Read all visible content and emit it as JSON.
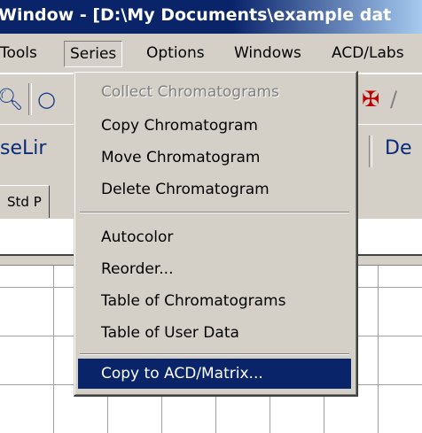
{
  "window": {
    "title": "Window - [D:\\My Documents\\example dat"
  },
  "menubar": {
    "items": [
      "Tools",
      "Series",
      "Options",
      "Windows",
      "ACD/Labs"
    ]
  },
  "toolbar": {
    "icons": [
      "zoom-icon",
      "pan-icon",
      "peak-marker-icon",
      "baseline-icon"
    ]
  },
  "toolbar2": {
    "left_label": "seLir",
    "right_label": "De"
  },
  "tabs": {
    "first": "Std P"
  },
  "series_menu": {
    "items": [
      {
        "label": "Collect Chromatograms",
        "state": "disabled"
      },
      {
        "label": "Copy Chromatogram",
        "state": "normal"
      },
      {
        "label": "Move Chromatogram",
        "state": "normal"
      },
      {
        "label": "Delete Chromatogram",
        "state": "normal"
      },
      {
        "label": "Autocolor",
        "state": "normal"
      },
      {
        "label": "Reorder...",
        "state": "normal"
      },
      {
        "label": "Table of Chromatograms",
        "state": "normal"
      },
      {
        "label": "Table of User Data",
        "state": "normal"
      },
      {
        "label": "Copy to ACD/Matrix...",
        "state": "selected"
      }
    ]
  },
  "colors": {
    "titlebar": "#0a246a",
    "selection": "#0a246a",
    "face": "#d4d0c8"
  }
}
